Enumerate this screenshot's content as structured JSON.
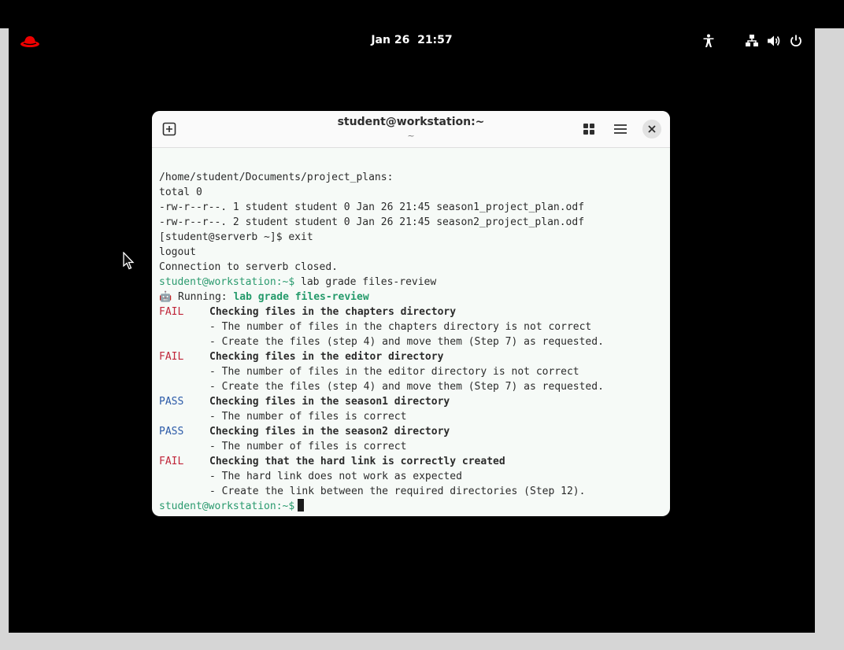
{
  "topbar": {
    "date": "Jan 26",
    "time": "21:57",
    "icons": [
      "redhat-logo-icon",
      "accessibility-icon",
      "network-icon",
      "volume-icon",
      "power-icon"
    ]
  },
  "terminal": {
    "title": "student@workstation:~",
    "subtitle": "~",
    "prompt": "student@workstation:~$",
    "lines": {
      "l1": "/home/student/Documents/project_plans:",
      "l2": "total 0",
      "l3": "-rw-r--r--. 1 student student 0 Jan 26 21:45 season1_project_plan.odf",
      "l4": "-rw-r--r--. 2 student student 0 Jan 26 21:45 season2_project_plan.odf",
      "l5": "[student@serverb ~]$ exit",
      "l6": "logout",
      "l7": "Connection to serverb closed."
    },
    "command": " lab grade files-review",
    "running_label": "🤖 Running: ",
    "running_cmd": "lab grade files-review",
    "checks": [
      {
        "status": "FAIL",
        "title": "Checking files in the chapters directory",
        "details": [
          "- The number of files in the chapters directory is not correct",
          "- Create the files (step 4) and move them (Step 7) as requested."
        ]
      },
      {
        "status": "FAIL",
        "title": "Checking files in the editor directory",
        "details": [
          "- The number of files in the editor directory is not correct",
          "- Create the files (step 4) and move them (Step 7) as requested."
        ]
      },
      {
        "status": "PASS",
        "title": "Checking files in the season1 directory",
        "details": [
          "- The number of files is correct"
        ]
      },
      {
        "status": "PASS",
        "title": "Checking files in the season2 directory",
        "details": [
          "- The number of files is correct"
        ]
      },
      {
        "status": "FAIL",
        "title": "Checking that the hard link is correctly created",
        "details": [
          "- The hard link does not work as expected",
          "- Create the link between the required directories (Step 12)."
        ]
      }
    ]
  },
  "colors": {
    "prompt": "#2a9a6e",
    "fail": "#c0263a",
    "pass": "#2b5aa8",
    "accent": "#ee0000"
  }
}
